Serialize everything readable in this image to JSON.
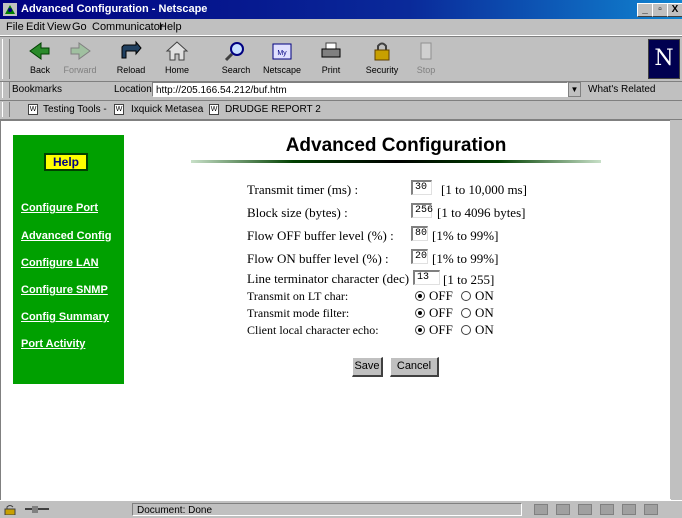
{
  "window": {
    "title": "Advanced Configuration - Netscape",
    "buttons": [
      "_",
      "▫",
      "X"
    ]
  },
  "menu": [
    "File",
    "Edit",
    "View",
    "Go",
    "Communicator",
    "Help"
  ],
  "toolbar": [
    {
      "label": "Back",
      "icon": "back-arrow-icon",
      "enabled": true
    },
    {
      "label": "Forward",
      "icon": "forward-arrow-icon",
      "enabled": false
    },
    {
      "label": "Reload",
      "icon": "reload-icon",
      "enabled": true
    },
    {
      "label": "Home",
      "icon": "home-icon",
      "enabled": true
    },
    {
      "label": "Search",
      "icon": "search-icon",
      "enabled": true
    },
    {
      "label": "Netscape",
      "icon": "netscape-icon",
      "enabled": true
    },
    {
      "label": "Print",
      "icon": "print-icon",
      "enabled": true
    },
    {
      "label": "Security",
      "icon": "lock-icon",
      "enabled": true
    },
    {
      "label": "Stop",
      "icon": "stop-icon",
      "enabled": false
    }
  ],
  "location": {
    "bookmarks_label": "Bookmarks",
    "label": "Location:",
    "url": "http://205.166.54.212/buf.htm",
    "related": "What's Related"
  },
  "personal_toolbar": [
    "Testing Tools -",
    "Ixquick Metasea",
    "DRUDGE REPORT 2"
  ],
  "sidebar": {
    "help": "Help",
    "links": [
      "Configure Port",
      "Advanced Config",
      "Configure LAN",
      "Configure SNMP",
      "Config Summary",
      "Port Activity"
    ]
  },
  "page": {
    "title": "Advanced Configuration",
    "fields": [
      {
        "label": "Transmit timer (ms) :",
        "value": "30",
        "hint": "[1 to 10,000 ms]"
      },
      {
        "label": "Block size (bytes) :",
        "value": "256",
        "hint": "[1 to 4096 bytes]"
      },
      {
        "label": "Flow OFF buffer level (%) :",
        "value": "80",
        "hint": "[1% to 99%]"
      },
      {
        "label": "Flow ON buffer level (%) :",
        "value": "20",
        "hint": "[1% to 99%]"
      },
      {
        "label": "Line terminator character (dec) :",
        "value": "13",
        "hint": "[1 to 255]"
      }
    ],
    "radios": [
      {
        "label": "Transmit on LT char:",
        "off": "OFF",
        "on": "ON",
        "selected": "OFF"
      },
      {
        "label": "Transmit mode filter:",
        "off": "OFF",
        "on": "ON",
        "selected": "OFF"
      },
      {
        "label": "Client local character echo:",
        "off": "OFF",
        "on": "ON",
        "selected": "OFF"
      }
    ],
    "save": "Save",
    "cancel": "Cancel"
  },
  "status": {
    "text": "Document: Done"
  },
  "colors": {
    "sidebar": "#00a000",
    "help_button": "#ffff00",
    "title_bar": "#000080"
  }
}
